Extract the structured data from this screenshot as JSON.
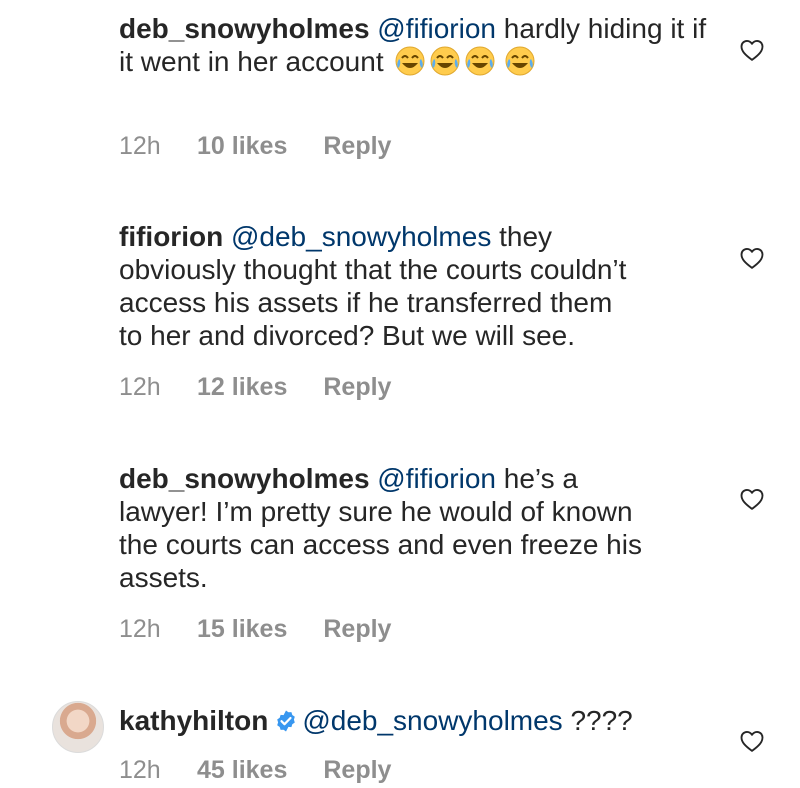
{
  "comments": [
    {
      "username": "deb_snowyholmes",
      "mention": "@fifiorion",
      "text": "hardly hiding it if it went in her account",
      "emoji": "face-with-tears-of-joy",
      "time": "12h",
      "likes": "10 likes",
      "reply": "Reply"
    },
    {
      "username": "fifiorion",
      "mention": "@deb_snowyholmes",
      "text_line1": "they",
      "text_line2": "obviously thought that the courts couldn’t",
      "text_line3": "access his assets if he transferred them",
      "text_line4": "to her and divorced? But we will see.",
      "time": "12h",
      "likes": "12 likes",
      "reply": "Reply"
    },
    {
      "username": "deb_snowyholmes",
      "mention": "@fifiorion",
      "text_line1": "he’s a",
      "text_line2": "lawyer! I’m pretty sure he would of known",
      "text_line3": "the courts can access and even freeze his",
      "text_line4": "assets.",
      "time": "12h",
      "likes": "15 likes",
      "reply": "Reply"
    },
    {
      "username": "kathyhilton",
      "verified": true,
      "mention": "@deb_snowyholmes",
      "text": "????",
      "time": "12h",
      "likes": "45 likes",
      "reply": "Reply"
    }
  ],
  "colors": {
    "text": "#262626",
    "mention": "#00376b",
    "meta": "#8e8e8e",
    "verified": "#3897f0"
  }
}
